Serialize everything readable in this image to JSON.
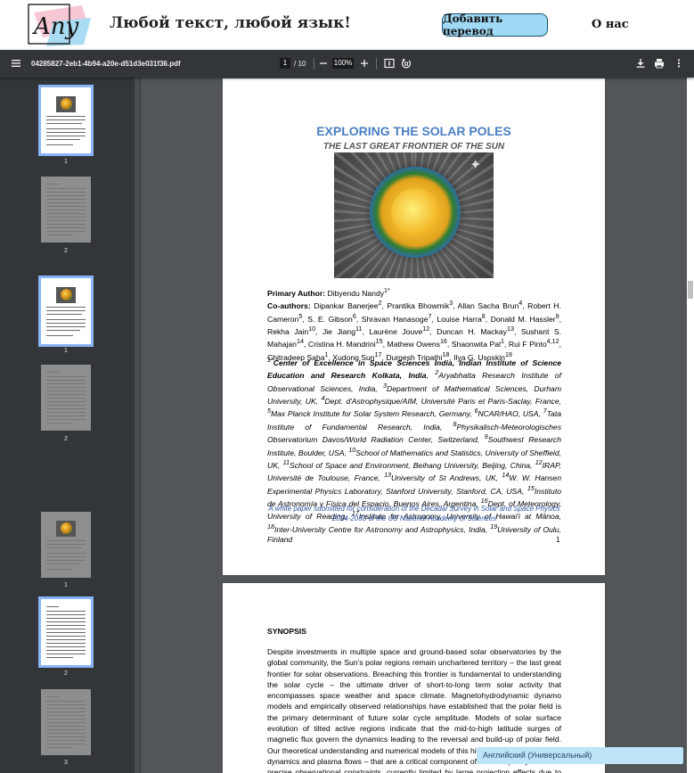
{
  "site": {
    "tagline": "Любой текст, любой язык!",
    "add_translation": "Добавить перевод",
    "about": "О нас",
    "logo_text": "Any"
  },
  "toolbar": {
    "filename": "04285827-2eb1-4b94-a20e-d51d3e031f36.pdf",
    "current_page": "1",
    "total_pages": "/ 10",
    "zoom": "100%",
    "icons": [
      "menu-icon",
      "zoom-out-icon",
      "zoom-in-icon",
      "fit-page-icon",
      "rotate-icon",
      "download-icon",
      "print-icon",
      "more-icon"
    ]
  },
  "thumbnails": [
    "1",
    "2",
    "1",
    "2",
    "1",
    "2",
    "3"
  ],
  "page1": {
    "title": "EXPLORING THE SOLAR POLES",
    "subtitle": "THE LAST GREAT FRONTIER OF THE SUN",
    "authors_label": "Primary Author:",
    "primary_author": "Dibyendu Nandy",
    "primary_author_sup": "1*",
    "coauthors_label": "Co-authors:",
    "coauthors": [
      [
        "Dipankar Banerjee",
        "2"
      ],
      [
        "Prantika Bhowmik",
        "3"
      ],
      [
        "Allan Sacha Brun",
        "4"
      ],
      [
        "Robert H. Cameron",
        "5"
      ],
      [
        "S. E. Gibson",
        "6"
      ],
      [
        "Shravan Hanasoge",
        "7"
      ],
      [
        "Louise Harra",
        "8"
      ],
      [
        "Donald M. Hassler",
        "9"
      ],
      [
        "Rekha Jain",
        "10"
      ],
      [
        "Jie Jiang",
        "11"
      ],
      [
        "Laurène Jouve",
        "12"
      ],
      [
        "Duncan H. Mackay",
        "13"
      ],
      [
        "Sushant S. Mahajan",
        "14"
      ],
      [
        "Cristina H. Mandrini",
        "15"
      ],
      [
        "Mathew Owens",
        "16"
      ],
      [
        "Shaonwita Pal",
        "1"
      ],
      [
        "Rui F Pinto",
        "4,12"
      ],
      [
        "Chitradeep Saha",
        "1"
      ],
      [
        "Xudong Sun",
        "17"
      ],
      [
        "Durgesh Tripathi",
        "18"
      ],
      [
        "Ilya G. Usoskin",
        "19"
      ]
    ],
    "affiliations": [
      [
        "1*",
        "Center of Excellence in Space Sciences India, Indian Institute of Science Education and Research Kolkata, India",
        true
      ],
      [
        "2",
        "Aryabhatta Research Institute of Observational Sciences, India",
        false
      ],
      [
        "3",
        "Department of Mathematical Sciences, Durham University, UK",
        false
      ],
      [
        "4",
        "Dept. d'Astrophysique/AIM, Université Paris et Paris-Saclay, France",
        false
      ],
      [
        "5",
        "Max Planck Institute for Solar System Research, Germany",
        false
      ],
      [
        "6",
        "NCAR/HAO, USA",
        false
      ],
      [
        "7",
        "Tata Institute of Fundamental Research, India",
        false
      ],
      [
        "8",
        "Physikalisch-Meteorologisches Observatorium Davos/World Radiation Center, Switzerland",
        false
      ],
      [
        "9",
        "Southwest Research Institute, Boulder, USA",
        false
      ],
      [
        "10",
        "School of Mathematics and Statistics, University of Sheffield, UK",
        false
      ],
      [
        "11",
        "School of Space and Environment, Beihang University, Beijing, China",
        false
      ],
      [
        "12",
        "IRAP, Université de Toulouse, France",
        false
      ],
      [
        "13",
        "University of St Andrews, UK",
        false
      ],
      [
        "14",
        "W. W. Hansen Experimental Physics Laboratory, Stanford University, Stanford, CA, USA",
        false
      ],
      [
        "15",
        "Instituto de Astronomía y Física del Espacio, Buenos Aires, Argentina",
        false
      ],
      [
        "16",
        "Dept. of Meteorology, University of Reading",
        false
      ],
      [
        "17",
        "Institute for Astronomy, University of Hawai'i at Mānoa",
        false
      ],
      [
        "18",
        "Inter-University Centre for Astronomy and Astrophysics, India",
        false
      ],
      [
        "19",
        "University of Oulu, Finland",
        false
      ]
    ],
    "whitepaper_line1": "A white paper submitted for consideration of the Decadal Survey in Solar and Space Physics",
    "whitepaper_line2": "2024-2033 of the US National Academy of Sciences",
    "page_number": "1"
  },
  "page2": {
    "heading": "SYNOPSIS",
    "text": "Despite investments in multiple space and ground-based solar observatories by the global community, the Sun's polar regions remain unchartered territory – the last great frontier for solar observations. Breaching this frontier is fundamental to understanding the solar cycle – the ultimate driver of short-to-long term solar activity that encompasses space weather and space climate. Magnetohydrodynamic dynamo models and empirically observed relationships have established that the polar field is the primary determinant of future solar cycle amplitude. Models of solar surface evolution of tilted active regions indicate that the mid-to-high latitude surges of magnetic flux govern the dynamics leading to the reversal and build-up of polar field. Our theoretical understanding and numerical models of this high latitude magnetic field dynamics and plasma flows – that are a critical component of the sunspot cycle – lack precise observational constraints, currently limited by large projection effects due to our vantage point in the plane of the ecliptic. This limitation compromises our ability to observe the"
  },
  "language_bar": "Английский (Универсальный)",
  "colors": {
    "toolbar": "#323639",
    "viewer_bg": "#525659",
    "title_blue": "#4a7ec2",
    "button_bg": "#9fd9f5",
    "thumb_selected": "#8ab4f8"
  }
}
